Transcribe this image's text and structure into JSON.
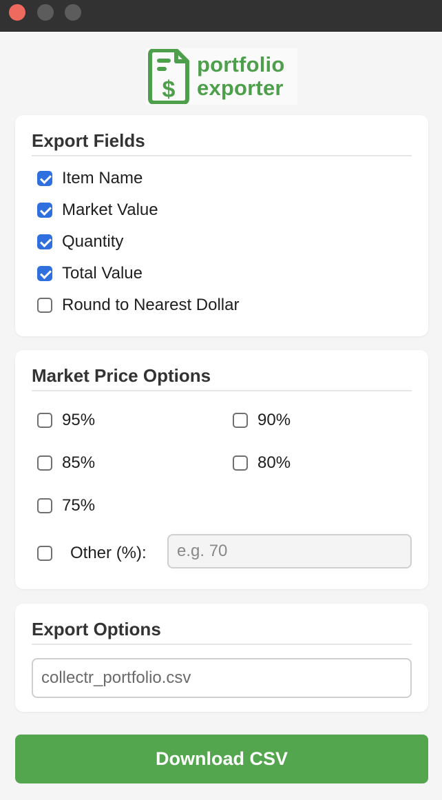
{
  "window": {
    "close_color": "#ee6a5f"
  },
  "logo": {
    "line1": "portfolio",
    "line2": "exporter",
    "icon": "dollar-document-icon",
    "brand_color": "#4e9f4b"
  },
  "export_fields": {
    "title": "Export Fields",
    "items": [
      {
        "label": "Item Name",
        "checked": true
      },
      {
        "label": "Market Value",
        "checked": true
      },
      {
        "label": "Quantity",
        "checked": true
      },
      {
        "label": "Total Value",
        "checked": true
      },
      {
        "label": "Round to Nearest Dollar",
        "checked": false
      }
    ]
  },
  "market_price": {
    "title": "Market Price Options",
    "options": [
      {
        "label": "95%",
        "checked": false
      },
      {
        "label": "90%",
        "checked": false
      },
      {
        "label": "85%",
        "checked": false
      },
      {
        "label": "80%",
        "checked": false
      },
      {
        "label": "75%",
        "checked": false
      }
    ],
    "other_label": "Other (%):",
    "other_checked": false,
    "other_placeholder": "e.g. 70"
  },
  "export_options": {
    "title": "Export Options",
    "filename_value": "collectr_portfolio.csv"
  },
  "download": {
    "label": "Download CSV",
    "color": "#53a64e"
  },
  "accent_color": "#2f6fde"
}
